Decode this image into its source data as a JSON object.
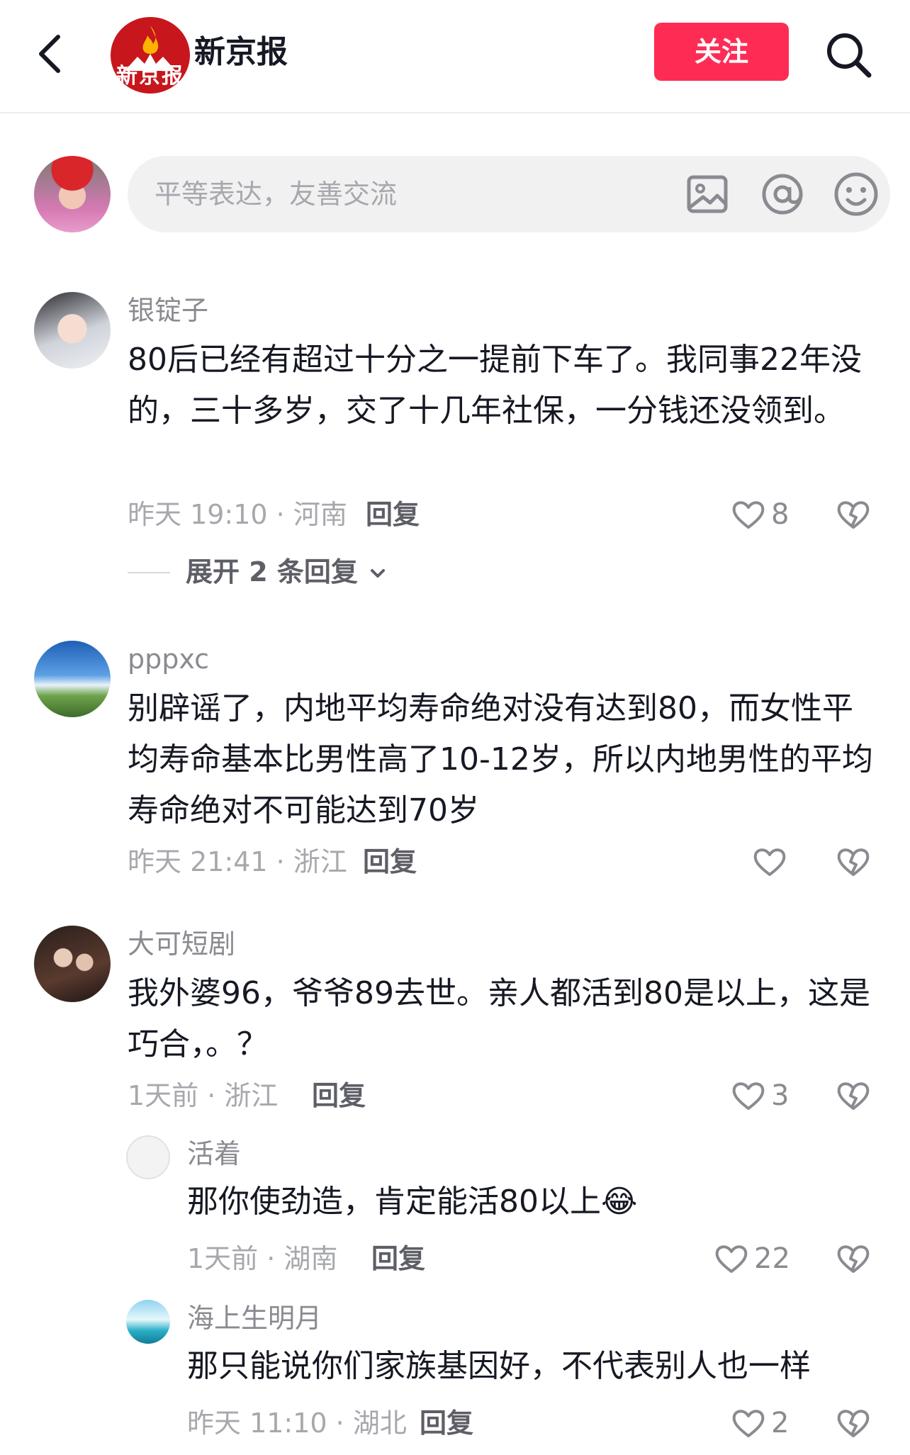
{
  "header": {
    "logo_text": "新京报",
    "title": "新京报",
    "follow_label": "关注",
    "brand_color": "#fe2c55",
    "logo_color": "#c8161d"
  },
  "input": {
    "placeholder": "平等表达，友善交流"
  },
  "comments": [
    {
      "username": "银锭子",
      "text": "80后已经有超过十分之一提前下车了。我同事22年没的，三十多岁，交了十几年社保，一分钱还没领到。",
      "meta": "昨天 19:10 · 河南",
      "reply": "回复",
      "likes": "8",
      "expand": "展开 2 条回复"
    },
    {
      "username": "pppxc",
      "text": "别辟谣了，内地平均寿命绝对没有达到80，而女性平均寿命基本比男性高了10-12岁，所以内地男性的平均寿命绝对不可能达到70岁",
      "meta": "昨天 21:41 · 浙江",
      "reply": "回复",
      "likes": ""
    },
    {
      "username": "大可短剧",
      "text": "我外婆96，爷爷89去世。亲人都活到80是以上，这是巧合，。？",
      "meta": "1天前 · 浙江",
      "reply": "回复",
      "likes": "3",
      "replies": [
        {
          "username": "活着",
          "text": "那你使劲造，肯定能活80以上😂",
          "meta": "1天前 · 湖南",
          "reply": "回复",
          "likes": "22"
        },
        {
          "username": "海上生明月",
          "text": "那只能说你们家族基因好，不代表别人也一样",
          "meta": "昨天 11:10 · 湖北",
          "reply": "回复",
          "likes": "2"
        }
      ]
    }
  ]
}
